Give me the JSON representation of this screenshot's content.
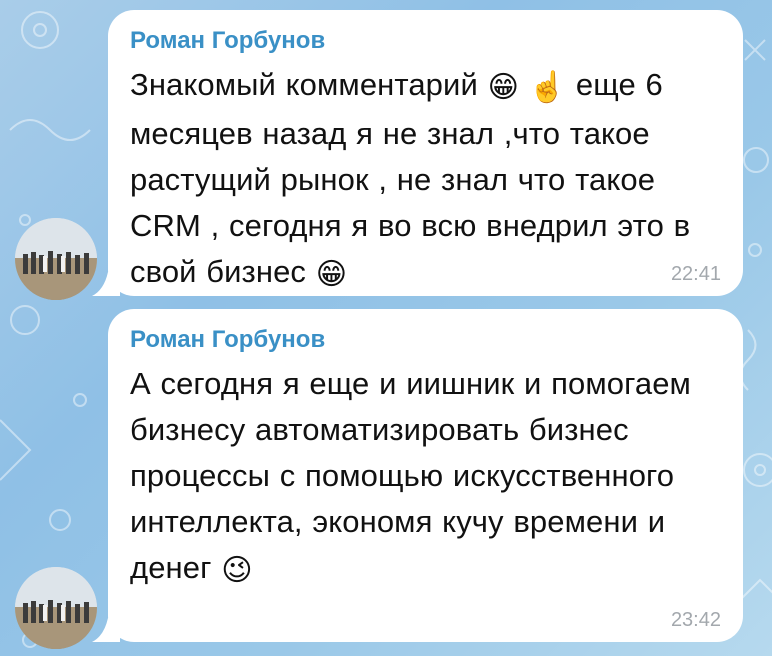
{
  "messages": [
    {
      "sender": "Роман Горбунов",
      "text_parts": [
        "Знакомый комментарий ",
        "😁",
        " ",
        "☝️",
        " еще 6 месяцев назад я не знал ,что такое растущий рынок , не знал что такое CRM , сегодня я во всю внедрил это в свой бизнес ",
        "😁"
      ],
      "time": "22:41"
    },
    {
      "sender": "Роман Горбунов",
      "text_parts": [
        "А сегодня я еще и иишник и помогаем бизнесу автоматизировать бизнес процессы с помощью искусственного интеллекта, экономя кучу времени и денег ",
        "😉"
      ],
      "time": "23:42"
    }
  ]
}
